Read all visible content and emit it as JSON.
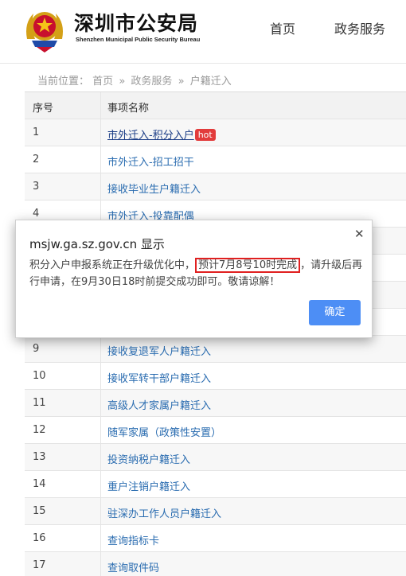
{
  "header": {
    "logo_cn": "深圳市公安局",
    "logo_en": "Shenzhen Municipal Public Security Bureau",
    "nav": [
      {
        "label": "首页"
      },
      {
        "label": "政务服务"
      }
    ]
  },
  "breadcrumb": {
    "prefix": "当前位置：",
    "items": [
      "首页",
      "政务服务",
      "户籍迁入"
    ],
    "separator": "»"
  },
  "table": {
    "headers": [
      "序号",
      "事项名称"
    ],
    "rows": [
      {
        "no": "1",
        "name": "市外迁入-积分入户",
        "badge": "hot"
      },
      {
        "no": "2",
        "name": "市外迁入-招工招干"
      },
      {
        "no": "3",
        "name": "接收毕业生户籍迁入"
      },
      {
        "no": "4",
        "name": "市外迁入-投靠配偶"
      },
      {
        "no": "9",
        "name": "接收复退军人户籍迁入"
      },
      {
        "no": "10",
        "name": "接收军转干部户籍迁入"
      },
      {
        "no": "11",
        "name": "高级人才家属户籍迁入"
      },
      {
        "no": "12",
        "name": "随军家属（政策性安置）"
      },
      {
        "no": "13",
        "name": "投资纳税户籍迁入"
      },
      {
        "no": "14",
        "name": "重户注销户籍迁入"
      },
      {
        "no": "15",
        "name": "驻深办工作人员户籍迁入"
      },
      {
        "no": "16",
        "name": "查询指标卡"
      },
      {
        "no": "17",
        "name": "查询取件码"
      }
    ]
  },
  "dialog": {
    "title": "msjw.ga.sz.gov.cn 显示",
    "message_before": "积分入户申报系统正在升级优化中，",
    "message_highlight": "预计7月8号10时完成",
    "message_after": "，请升级后再行申请，在9月30日18时前提交成功即可。敬请谅解！",
    "ok_label": "确定",
    "close_symbol": "✕"
  },
  "colors": {
    "link": "#2a6cb0",
    "hot_badge": "#e23b3b",
    "highlight_border": "#e02020",
    "ok_button": "#4d8ef5"
  }
}
